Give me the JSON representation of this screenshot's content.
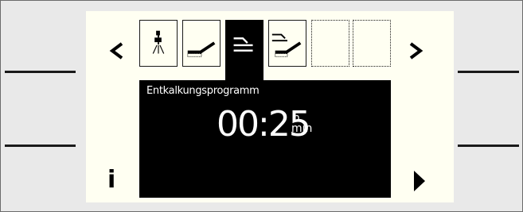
{
  "display": {
    "program_label": "Entkalkungsprogramm",
    "time_value": "00:25",
    "unit_hours": "h",
    "unit_minutes": "min",
    "info_label": "i"
  },
  "tabs": [
    {
      "icon": "spray-nozzle-icon",
      "state": "normal"
    },
    {
      "icon": "brush-cleaning-icon",
      "state": "normal"
    },
    {
      "icon": "descaling-icon",
      "state": "selected"
    },
    {
      "icon": "descaling-brush-icon",
      "state": "normal"
    },
    {
      "icon": "",
      "state": "empty"
    },
    {
      "icon": "",
      "state": "empty"
    }
  ],
  "colors": {
    "screen_background": "#fffff2",
    "panel_background": "#000000",
    "text": "#ffffff"
  }
}
